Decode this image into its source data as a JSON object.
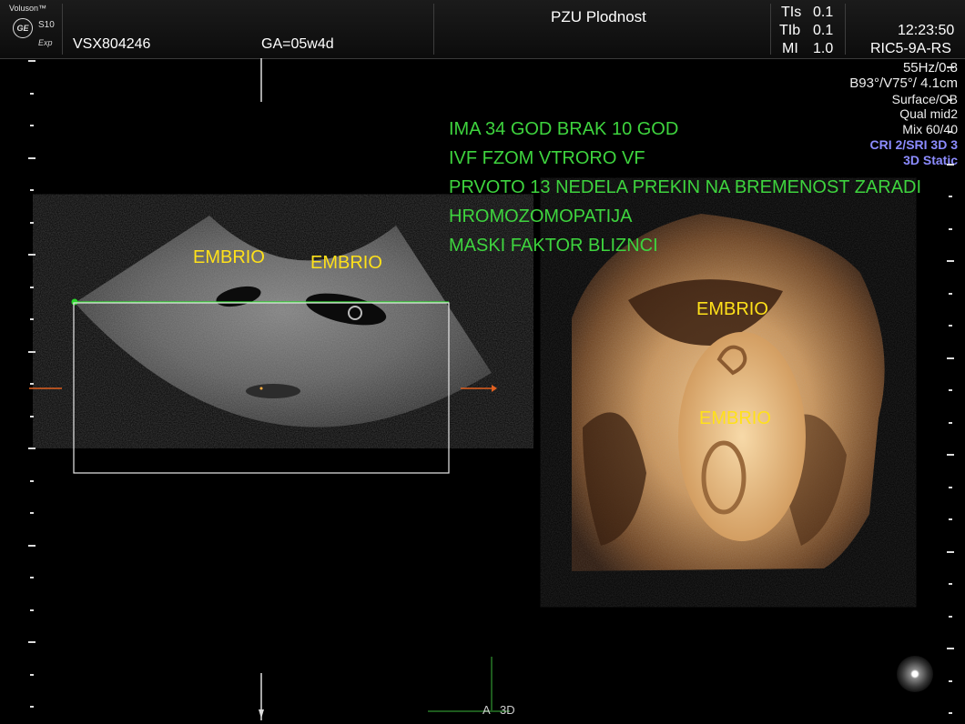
{
  "header": {
    "brand": "Voluson™",
    "logo_text": "GE",
    "model": "S10",
    "model_sub": "Exp",
    "patient_id": "VSX804246",
    "ga": "GA=05w4d",
    "clinic": "PZU Plodnost",
    "tis": {
      "label": "TIs",
      "value": "0.1"
    },
    "tib": {
      "label": "TIb",
      "value": "0.1"
    },
    "mi": {
      "label": "MI",
      "value": "1.0"
    },
    "time": "12:23:50",
    "probe": "RIC5-9A-RS"
  },
  "info_panel": [
    "55Hz/0.8",
    "B93°/V75°/ 4.1cm",
    "Surface/OB",
    "Qual mid2",
    "Mix 60/40"
  ],
  "info_blue": [
    "CRI 2/SRI 3D 3",
    "3D Static"
  ],
  "notes": [
    "IMA 34 GOD BRAK 10 GOD",
    "IVF FZOM VTRORO VF",
    "PRVOTO 13 NEDELA PREKIN NA BREMENOST ZARADI",
    "HROMOZOMOPATIJA",
    "MASKI FAKTOR BLIZNCI"
  ],
  "labels": {
    "embrio_1": "EMBRIO",
    "embrio_2": "EMBRIO",
    "embrio_3": "EMBRIO",
    "embrio_4": "EMBRIO"
  },
  "bottom": {
    "a": "A",
    "three_d": "3D"
  },
  "colors": {
    "annotation": "#3ed43e",
    "label": "#ffe11a",
    "info_accent": "#8c8cff",
    "render_tone": "#c9945a"
  }
}
